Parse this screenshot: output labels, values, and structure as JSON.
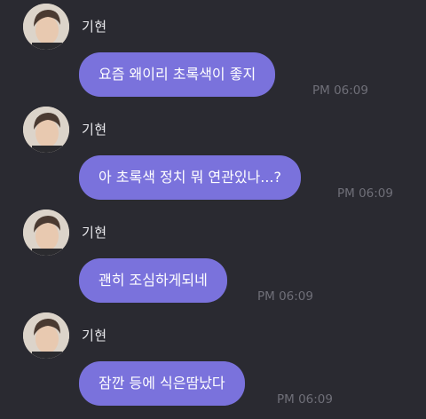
{
  "colors": {
    "background": "#2a2a31",
    "bubble": "#7a72dc",
    "bubble_text": "#ffffff",
    "sender_text": "#e8e8ec",
    "time_text": "#6f6f78"
  },
  "messages": [
    {
      "sender": "기현",
      "text": "요즘 왜이리 초록색이 좋지",
      "time": "PM 06:09"
    },
    {
      "sender": "기현",
      "text": "아 초록색 정치 뭐 연관있나...?",
      "time": "PM 06:09"
    },
    {
      "sender": "기현",
      "text": "괜히 조심하게되네",
      "time": "PM 06:09"
    },
    {
      "sender": "기현",
      "text": "잠깐 등에 식은땀났다",
      "time": "PM 06:09"
    }
  ]
}
